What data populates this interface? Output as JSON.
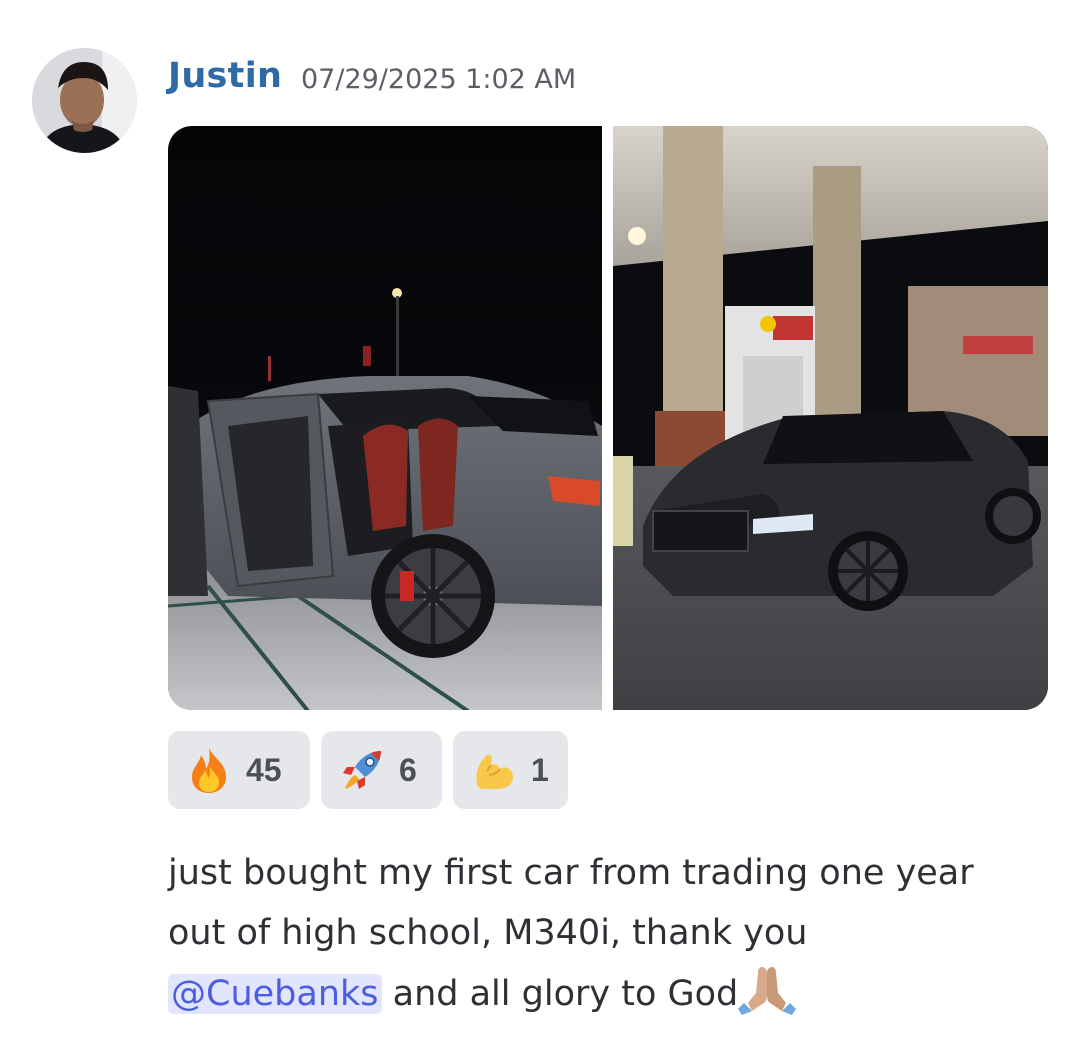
{
  "message": {
    "author": "Justin",
    "timestamp": "07/29/2025 1:02 AM",
    "avatar_icon": "user-photo-avatar",
    "attachments": [
      {
        "name": "car-door-open-photo",
        "description_icon": "image"
      },
      {
        "name": "car-gas-station-photo",
        "description_icon": "image"
      }
    ],
    "reactions": [
      {
        "emoji": "fire-icon",
        "count": "45"
      },
      {
        "emoji": "rocket-icon",
        "count": "6"
      },
      {
        "emoji": "flexed-biceps-icon",
        "count": "1"
      }
    ],
    "text": {
      "line1": "just bought my first car from trading one year",
      "line2": "out of high school, M340i, thank you",
      "mention": "@Cuebanks",
      "line3_rest": " and all glory to God",
      "end_emoji": "folded-hands-icon"
    }
  },
  "colors": {
    "author": "#2d6aa6",
    "timestamp": "#5c5e66",
    "mention_bg": "#e1e5fd",
    "mention_text": "#4e5de0",
    "reaction_bg": "#e6e7ea"
  }
}
